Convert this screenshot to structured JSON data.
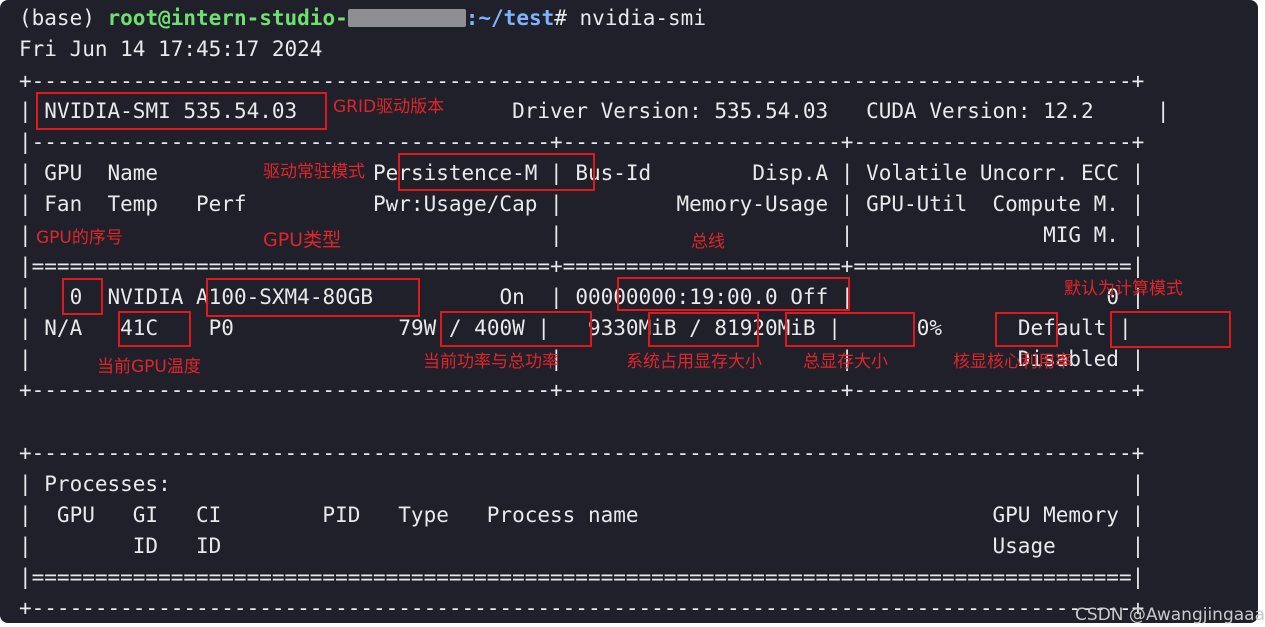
{
  "prompt": {
    "prefix": "(base) ",
    "user_host": "root@intern-studio-",
    "masked_host": "",
    "sep": ":",
    "path": "~/test",
    "suffix": "# nvidia-smi"
  },
  "date_line": "Fri Jun 14 17:45:17 2024",
  "smi": {
    "border_top": "+---------------------------------------------------------------------------------------+",
    "header_left": "| ",
    "smi_version": "NVIDIA-SMI 535.54.03",
    "header_right": "                 Driver Version: 535.54.03   CUDA Version: 12.2     |",
    "sep_header": "|-----------------------------------------+----------------------+----------------------+",
    "col_row1_left": "| GPU  Name                 ",
    "col_persistence": "Persistence-M",
    "col_row1_right": " | Bus-Id        Disp.A | Volatile Uncorr. ECC |",
    "col_row2": "| Fan  Temp   Perf          Pwr:Usage/Cap |         Memory-Usage | GPU-Util  Compute M. |",
    "col_row3": "|                                         |                      |               MIG M. |",
    "sep_double": "|=========================================+======================+======================|",
    "gpu_row1_a": "|   ",
    "gpu_index": "0",
    "gpu_row1_b": "  NVIDIA ",
    "gpu_model": "A100-SXM4-80GB",
    "gpu_row1_c": "          On  | ",
    "bus_id": "00000000:19:00.0",
    "gpu_row1_d": " Off |                    0 |",
    "gpu_row2_a": "| N/A   ",
    "temp": "41C",
    "gpu_row2_b": "    P0             ",
    "power": "79W / 400W",
    "gpu_row2_c": " |   ",
    "mem_used": "9330MiB",
    "mem_sep": " / ",
    "mem_total": "81920MiB",
    "gpu_row2_d": " |      ",
    "util": "0%",
    "gpu_row2_e": "      ",
    "compute_mode": "Default",
    "gpu_row2_f": " |",
    "gpu_row3": "|                                         |                      |             Disabled |",
    "border_bottom": "+-----------------------------------------+----------------------+----------------------+",
    "proc_top": "+---------------------------------------------------------------------------------------+",
    "proc_title": "| Processes:                                                                            |",
    "proc_cols1": "|  GPU   GI   CI        PID   Type   Process name                            GPU Memory |",
    "proc_cols2": "|        ID   ID                                                             Usage      |",
    "proc_double": "|=======================================================================================|",
    "proc_bottom": "+---------------------------------------------------------------------------------------+"
  },
  "annotations": {
    "grid_driver": "GRID驱动版本",
    "persistence": "驱动常驻模式",
    "gpu_index": "GPU的序号",
    "gpu_type": "GPU类型",
    "bus": "总线",
    "compute_mode": "默认为计算模式",
    "temp": "当前GPU温度",
    "power": "当前功率与总功率",
    "mem_used": "系统占用显存大小",
    "mem_total": "总显存大小",
    "util": "核显核心利用率"
  },
  "watermark": "CSDN @Awangjingaaa",
  "colors": {
    "terminal_bg": "#1f2029",
    "text": "#e9e9ec",
    "prompt_user": "#6fe06f",
    "prompt_path": "#7fb2ff",
    "annotation_red": "#e2252a"
  }
}
